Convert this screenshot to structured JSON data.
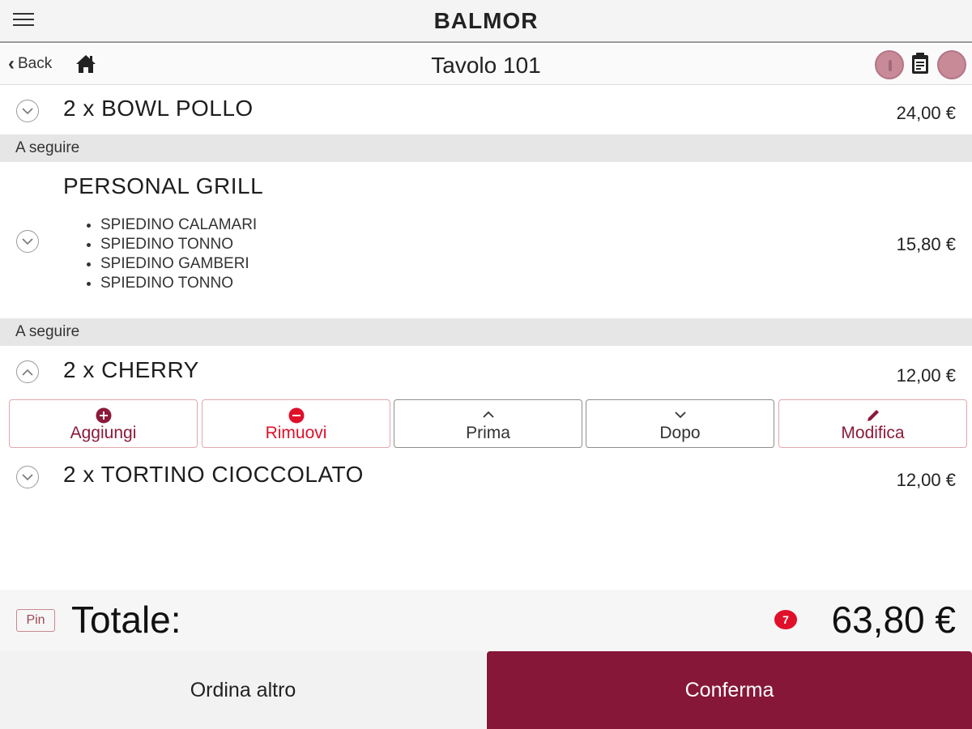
{
  "header": {
    "title": "BALMOR"
  },
  "subheader": {
    "back_label": "Back",
    "table_title": "Tavolo 101"
  },
  "items": [
    {
      "name": "2 x BOWL POLLO",
      "price": "24,00 €"
    },
    {
      "name": "PERSONAL GRILL",
      "price": "15,80 €",
      "sub_items": [
        "SPIEDINO CALAMARI",
        "SPIEDINO TONNO",
        "SPIEDINO GAMBERI",
        "SPIEDINO TONNO"
      ]
    },
    {
      "name": "2 x CHERRY",
      "price": "12,00 €"
    },
    {
      "name": "2 x TORTINO CIOCCOLATO",
      "price": "12,00 €"
    }
  ],
  "separators": [
    "A seguire",
    "A seguire"
  ],
  "actions": {
    "add": "Aggiungi",
    "remove": "Rimuovi",
    "before": "Prima",
    "after": "Dopo",
    "edit": "Modifica"
  },
  "footer": {
    "pin_label": "Pin",
    "total_label": "Totale:",
    "item_count": "7",
    "total_value": "63,80 €",
    "order_more_label": "Ordina altro",
    "confirm_label": "Conferma"
  },
  "colors": {
    "brand": "#861739",
    "add_icon": "#8b1a3a",
    "remove": "#e0102a",
    "edit_icon": "#8b1a3a"
  },
  "icons": [
    "menu-icon",
    "back-chevron-icon",
    "home-icon",
    "info-icon",
    "clipboard-icon",
    "more-icon",
    "chevron-down-icon",
    "chevron-up-icon",
    "plus-circle-icon",
    "minus-circle-icon",
    "pencil-icon"
  ]
}
